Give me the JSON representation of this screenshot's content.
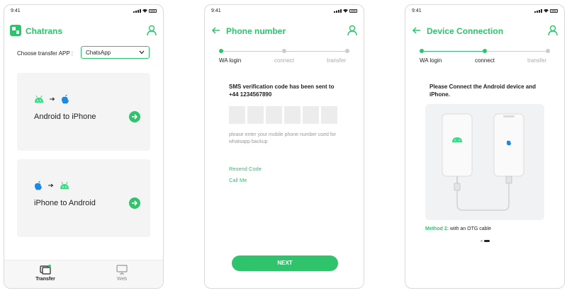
{
  "status": {
    "time": "9:41"
  },
  "screen1": {
    "app_title": "Chatrans",
    "choose_label": "Choose transfer APP :",
    "select_value": "ChatsApp",
    "card1_label": "Android to iPhone",
    "card2_label": "iPhone to Android",
    "tab_transfer": "Transfer",
    "tab_web": "Web"
  },
  "screen2": {
    "title": "Phone number",
    "steps": [
      "WA login",
      "connect",
      "transfer"
    ],
    "sms_line1": "SMS verification code has been sent to",
    "sms_line2": "+44 1234567890",
    "hint": "please enter your mobile phone number used for whatsapp backup",
    "resend": "Resend Code",
    "call": "Call Me",
    "next": "NEXT"
  },
  "screen3": {
    "title": "Device Connection",
    "steps": [
      "WA login",
      "connect",
      "transfer"
    ],
    "instruction": "Please Connect the Android device and iPhone.",
    "method_label": "Method 2:",
    "method_text": " with an OTG cable"
  },
  "colors": {
    "accent": "#2fc36c",
    "inactive": "#cccccc"
  }
}
